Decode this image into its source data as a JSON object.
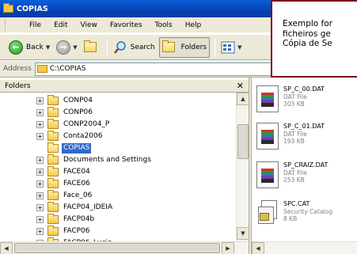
{
  "window": {
    "title": "COPIAS"
  },
  "menu": [
    "File",
    "Edit",
    "View",
    "Favorites",
    "Tools",
    "Help"
  ],
  "toolbar": {
    "back_label": "Back",
    "search_label": "Search",
    "folders_label": "Folders"
  },
  "address": {
    "label": "Address",
    "value": "C:\\COPIAS"
  },
  "folders_pane": {
    "title": "Folders",
    "close_glyph": "✕"
  },
  "tree": [
    {
      "label": "CONP04",
      "expander": "+"
    },
    {
      "label": "CONP06",
      "expander": "+"
    },
    {
      "label": "CONP2004_P",
      "expander": "+"
    },
    {
      "label": "Conta2006",
      "expander": "+"
    },
    {
      "label": "COPIAS",
      "expander": ""
    },
    {
      "label": "Documents and Settings",
      "expander": "+"
    },
    {
      "label": "FACE04",
      "expander": "+"
    },
    {
      "label": "FACE06",
      "expander": "+"
    },
    {
      "label": "Face_06",
      "expander": "+"
    },
    {
      "label": "FACP04_IDEIA",
      "expander": "+"
    },
    {
      "label": "FACP04b",
      "expander": "+"
    },
    {
      "label": "FACP06",
      "expander": "+"
    },
    {
      "label": "FACP06_Lucia",
      "expander": "+"
    }
  ],
  "files": [
    {
      "name": "SP_C_00.DAT",
      "type": "DAT File",
      "size": "203 KB"
    },
    {
      "name": "SP_C_01.DAT",
      "type": "DAT File",
      "size": "193 KB"
    },
    {
      "name": "SP_CRAIZ.DAT",
      "type": "DAT File",
      "size": "253 KB"
    },
    {
      "name": "SPC.CAT",
      "type": "Security Catalog",
      "size": "8 KB"
    }
  ],
  "callout": {
    "line1": "Exemplo for",
    "line2": "ficheiros ge",
    "line3": "Cópia de Se"
  }
}
